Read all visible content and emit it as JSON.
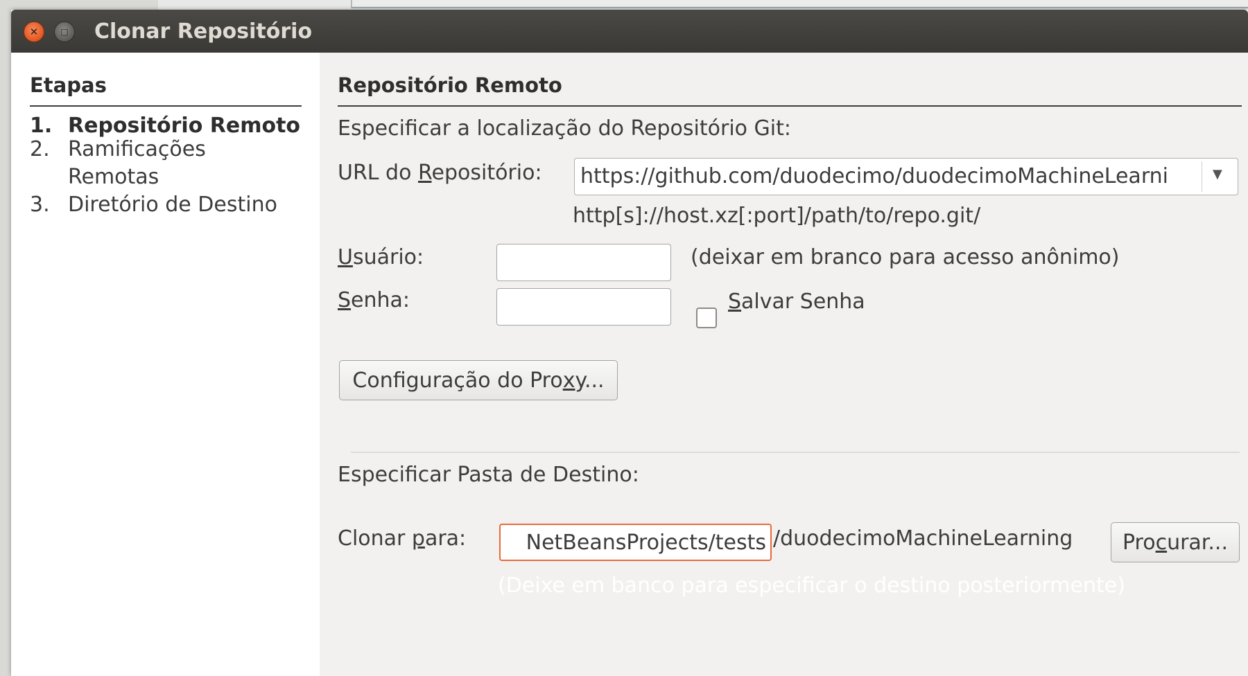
{
  "window": {
    "title": "Clonar Repositório"
  },
  "steps": {
    "heading": "Etapas",
    "items": [
      {
        "num": "1.",
        "label": "Repositório Remoto"
      },
      {
        "num": "2.",
        "label_line1": "Ramificações",
        "label_line2": "Remotas"
      },
      {
        "num": "3.",
        "label": "Diretório de Destino"
      }
    ]
  },
  "main": {
    "heading": "Repositório Remoto",
    "intro": "Especificar a localização do Repositório Git:",
    "url_label_pre": "URL do ",
    "url_label_mn": "R",
    "url_label_post": "epositório:",
    "url_value": "https://github.com/duodecimo/duodecimoMachineLearning",
    "url_hint": "http[s]://host.xz[:port]/path/to/repo.git/",
    "user_label_mn": "U",
    "user_label_post": "suário:",
    "user_value": "",
    "user_hint": "(deixar em branco para acesso anônimo)",
    "pass_label_mn": "S",
    "pass_label_post": "enha:",
    "pass_value": "",
    "save_pass_mn": "S",
    "save_pass_post": "alvar Senha",
    "save_pass_checked": false,
    "proxy_pre": "Configuração do Pro",
    "proxy_mn": "x",
    "proxy_post": "y...",
    "dest_heading": "Especificar Pasta de Destino:",
    "clone_label_pre": "Clonar ",
    "clone_label_mn": "p",
    "clone_label_post": "ara:",
    "clone_value": "NetBeansProjects/tests",
    "clone_suffix": "/duodecimoMachineLearning",
    "browse_pre": "Pro",
    "browse_mn": "c",
    "browse_post": "urar...",
    "dest_hint": "(Deixe em banco para especificar o destino posteriormente)"
  },
  "colors": {
    "titlebar": "#3c3b37",
    "close_button": "#e2561f",
    "focus_border": "#e8693a"
  }
}
